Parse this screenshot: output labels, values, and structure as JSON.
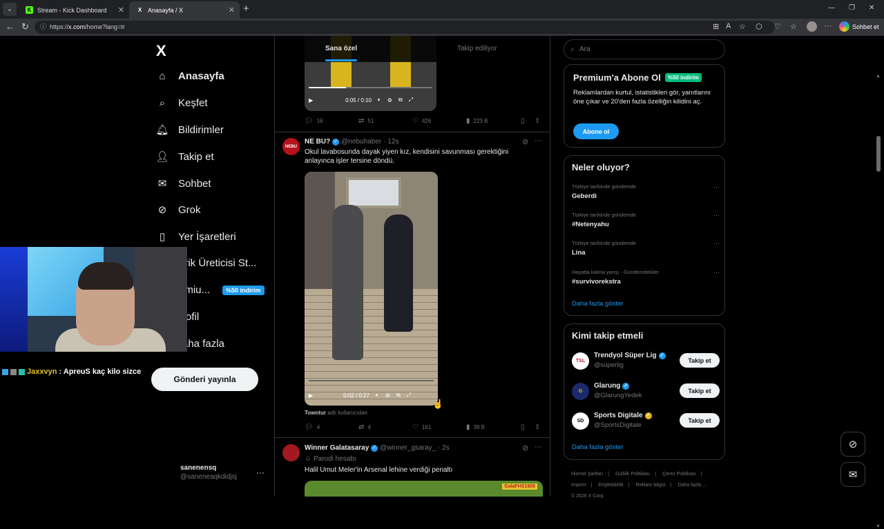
{
  "browser": {
    "tabs": [
      {
        "title": "Stream - Kick Dashboard",
        "favicon": "K",
        "active": false
      },
      {
        "title": "Anasayfa / X",
        "favicon": "X",
        "active": true
      }
    ],
    "url_scheme": "https://",
    "url_host": "x.com",
    "url_path": "/home?lang=tr",
    "copilot_label": "Sohbet et"
  },
  "nav": {
    "logo": "X",
    "items": [
      {
        "label": "Anasayfa",
        "icon": "home-icon"
      },
      {
        "label": "Keşfet",
        "icon": "search-icon"
      },
      {
        "label": "Bildirimler",
        "icon": "bell-icon"
      },
      {
        "label": "Takip et",
        "icon": "person-add-icon"
      },
      {
        "label": "Sohbet",
        "icon": "mail-icon"
      },
      {
        "label": "Grok",
        "icon": "grok-icon"
      },
      {
        "label": "Yer İşaretleri",
        "icon": "bookmark-icon"
      },
      {
        "label": "erik Üreticisi St...",
        "icon": "creator-icon"
      },
      {
        "label": "emiu...",
        "icon": "premium-icon"
      },
      {
        "label": "ofil",
        "icon": "profile-icon"
      },
      {
        "label": "aha fazla",
        "icon": "more-icon"
      }
    ],
    "premium_pill": "%50 indirim",
    "post_button": "Gönderi yayınla",
    "account": {
      "name": "sanenensq",
      "handle": "@saneneaqkdidjsj"
    }
  },
  "feed": {
    "tabs": [
      "Sana özel",
      "Takip ediliyor"
    ],
    "post0": {
      "video_time": "0:05 / 0:10",
      "actions": {
        "replies": "16",
        "reposts": "51",
        "likes": "426",
        "views": "223 B"
      }
    },
    "post1": {
      "name": "NE BU?",
      "handle": "@nebuhaber",
      "time": "· 12s",
      "avatar_text": "NEBU",
      "text": "Okul lavabosunda dayak yiyen kız, kendisini savunması gerektiğini anlayınca işler tersine döndü.",
      "video_time": "0:02 / 0:27",
      "credit_user": "Towntur",
      "credit_suffix": "adlı kullanıcıdan",
      "actions": {
        "replies": "4",
        "reposts": "4",
        "likes": "161",
        "views": "39 B"
      }
    },
    "post2": {
      "name": "Winner Galatasaray",
      "handle": "@winner_gsaray_",
      "time": "· 2s",
      "badge": "Parodi hesabı",
      "text": "Halil Umut Meler'in Arsenal lehine verdiği penaltı",
      "media_tag": "GalaFHS1905"
    }
  },
  "right": {
    "search_placeholder": "Ara",
    "premium": {
      "title": "Premium'a Abone Ol",
      "discount": "%50 indirim",
      "text": "Reklamlardan kurtul, istatistikleri gör, yanıtlarını öne çıkar ve 20'den fazla özelliğin kilidini aç.",
      "button": "Abone ol"
    },
    "trends": {
      "title": "Neler oluyor?",
      "items": [
        {
          "context": "Türkiye tarihinde gündemde",
          "topic": "Geberdi"
        },
        {
          "context": "Türkiye tarihinde gündemde",
          "topic": "#Netenyahu"
        },
        {
          "context": "Türkiye tarihinde gündemde",
          "topic": "Lina"
        },
        {
          "context": "Hayatta kalma yarışı · Gündemdekiler",
          "topic": "#survivorekstra"
        }
      ],
      "more": "Daha fazla göster"
    },
    "who": {
      "title": "Kimi takip etmeli",
      "items": [
        {
          "name": "Trendyol Süper Lig",
          "handle": "@superlig",
          "badge": "blue",
          "avatar": "TSL"
        },
        {
          "name": "Glarung",
          "handle": "@GlarungYedek",
          "badge": "blue",
          "avatar": "G"
        },
        {
          "name": "Sports Digitale",
          "handle": "@SportsDigitale",
          "badge": "gold",
          "avatar": "SD"
        }
      ],
      "follow_label": "Takip et",
      "more": "Daha fazla göster"
    },
    "footer": [
      "Hizmet Şartları",
      "|",
      "Gizlilik Politikası",
      "|",
      "Çerez Politikası",
      "|",
      "Imprint",
      "|",
      "Erişilebilirlik",
      "|",
      "Reklam bilgisi",
      "|",
      "Daha fazla ...",
      "© 2026 X Corp."
    ]
  },
  "stream_overlay": {
    "chat_user": "Jaxxvyn",
    "chat_message": ": ApreuS kaç kilo sizce"
  },
  "colors": {
    "accent": "#1d9bf0",
    "discount": "#00ba7c",
    "chat_user": "#e5c12b"
  }
}
